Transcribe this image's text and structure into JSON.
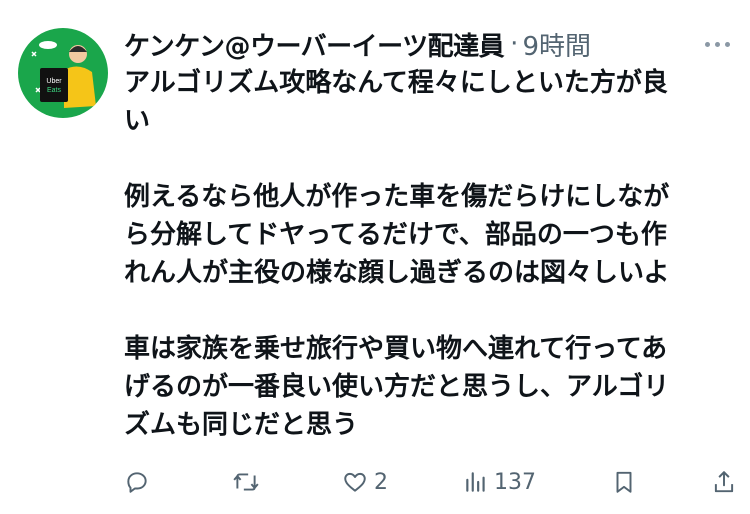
{
  "tweet": {
    "display_name": "ケンケン@ウーバーイーツ配達員",
    "separator": "·",
    "timestamp": "9時間",
    "avatar_text_line1": "Uber",
    "avatar_text_line2": "Eats",
    "paragraphs": [
      [
        "アルゴリズム攻略なんて程々にしといた方が良",
        "い"
      ],
      [
        "例えるなら他人が作った車を傷だらけにしなが",
        "ら分解してドヤってるだけで、部品の一つも作",
        "れん人が主役の様な顔し過ぎるのは図々しいよ"
      ],
      [
        "車は家族を乗せ旅行や買い物へ連れて行ってあ",
        "げるのが一番良い使い方だと思うし、アルゴリ",
        "ズムも同じだと思う"
      ]
    ]
  },
  "actions": {
    "reply_count": "",
    "retweet_count": "",
    "like_count": "2",
    "views_count": "137"
  },
  "icons": [
    "more-icon",
    "reply-icon",
    "retweet-icon",
    "like-icon",
    "views-icon",
    "bookmark-icon",
    "share-icon"
  ],
  "colors": {
    "text": "#0f1419",
    "secondary": "#536471",
    "avatar_bg": "#17a34a",
    "avatar_accent": "#f5c518"
  }
}
